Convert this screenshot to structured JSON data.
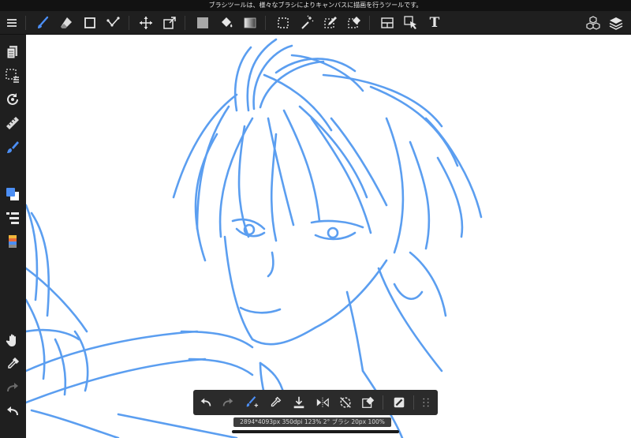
{
  "status_bar": {
    "hint": "ブラシツールは、様々なブラシによりキャンバスに描画を行うツールです。"
  },
  "toolbar": {
    "items": [
      {
        "icon": "menu-icon"
      },
      {
        "icon": "brush-icon",
        "selected": true
      },
      {
        "icon": "eraser-icon"
      },
      {
        "icon": "shape-icon"
      },
      {
        "icon": "edit-icon"
      },
      {
        "icon": "move-icon"
      },
      {
        "icon": "transform-icon"
      },
      {
        "icon": "fill-icon"
      },
      {
        "icon": "bucket-icon"
      },
      {
        "icon": "gradient-icon"
      },
      {
        "icon": "select-icon"
      },
      {
        "icon": "magic-wand-icon"
      },
      {
        "icon": "select-pen-icon"
      },
      {
        "icon": "select-eraser-icon"
      },
      {
        "icon": "frame-icon"
      },
      {
        "icon": "operation-icon"
      },
      {
        "icon": "text-icon",
        "label": "T"
      },
      {
        "icon": "material-icon"
      },
      {
        "icon": "layers-icon"
      }
    ]
  },
  "sidebar": {
    "items": [
      {
        "icon": "pages-icon"
      },
      {
        "icon": "selection-layer-icon"
      },
      {
        "icon": "rotate-icon"
      },
      {
        "icon": "ruler-icon"
      },
      {
        "icon": "brush-select-icon"
      },
      {
        "icon": "color-icon"
      },
      {
        "icon": "layer-list-icon"
      },
      {
        "icon": "palette-icon"
      },
      {
        "icon": "hand-icon"
      },
      {
        "icon": "eyedropper-icon"
      },
      {
        "icon": "redo-icon"
      },
      {
        "icon": "undo-icon"
      }
    ]
  },
  "float_bar": {
    "items": [
      {
        "icon": "undo-icon"
      },
      {
        "icon": "redo-icon"
      },
      {
        "icon": "brush-size-icon"
      },
      {
        "icon": "eyedropper-icon"
      },
      {
        "icon": "save-icon"
      },
      {
        "icon": "flip-icon"
      },
      {
        "icon": "rotate-reset-icon"
      },
      {
        "icon": "clear-icon"
      },
      {
        "icon": "snap-icon"
      },
      {
        "icon": "grid-icon"
      }
    ]
  },
  "info_bar": {
    "text": "2894*4093px 350dpi 123% 2° ブラシ 20px 100%"
  },
  "colors": {
    "stroke": "#5b9ef0",
    "chrome": "#1f1f1f",
    "accent": "#4c8ff5"
  }
}
